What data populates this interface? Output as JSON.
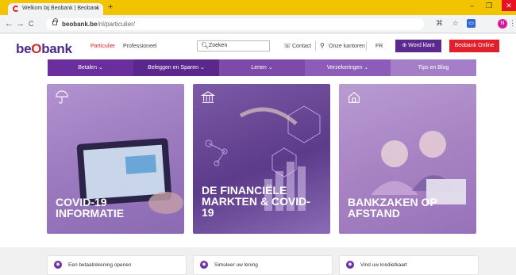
{
  "browser": {
    "tab_title": "Welkom bij Beobank | Beobank",
    "tab_close": "×",
    "new_tab": "+",
    "url_host": "beobank.be",
    "url_path": "/nl/particulier/",
    "back": "←",
    "forward": "→",
    "reload": "C",
    "avatar_initial": "N"
  },
  "header": {
    "logo_pre": "be",
    "logo_o": "O",
    "logo_post": "bank",
    "link_particulier": "Particulier",
    "link_professioneel": "Professioneel",
    "search_value": "Zoeken",
    "contact": "Contact",
    "kantoren": "Onze kantoren",
    "lang": "FR",
    "word_klant": "Word klant",
    "online": "Beobank Online"
  },
  "menu": [
    {
      "label": "Betalen ⌄"
    },
    {
      "label": "Beleggen en Sparen ⌄"
    },
    {
      "label": "Lenen ⌄"
    },
    {
      "label": "Verzekeringen ⌄"
    },
    {
      "label": "Tips en Blog"
    }
  ],
  "cards": [
    {
      "title_1": "COVID-19",
      "title_2": "INFORMATIE",
      "icon": "umbrella-icon"
    },
    {
      "title_1": "DE FINANCIËLE",
      "title_2": "MARKTEN & COVID-",
      "title_3": "19",
      "icon": "bank-icon"
    },
    {
      "title_1": "BANKZAKEN OP",
      "title_2": "AFSTAND",
      "icon": "home-icon"
    }
  ],
  "shortcuts": [
    {
      "label": "Een betaalrekening openen"
    },
    {
      "label": "Simuleer uw lening"
    },
    {
      "label": "Vind uw kredietkaart"
    }
  ],
  "colors": {
    "brand_purple": "#5b2a8f",
    "brand_red": "#e0202a",
    "tabbar": "#f2c400"
  }
}
